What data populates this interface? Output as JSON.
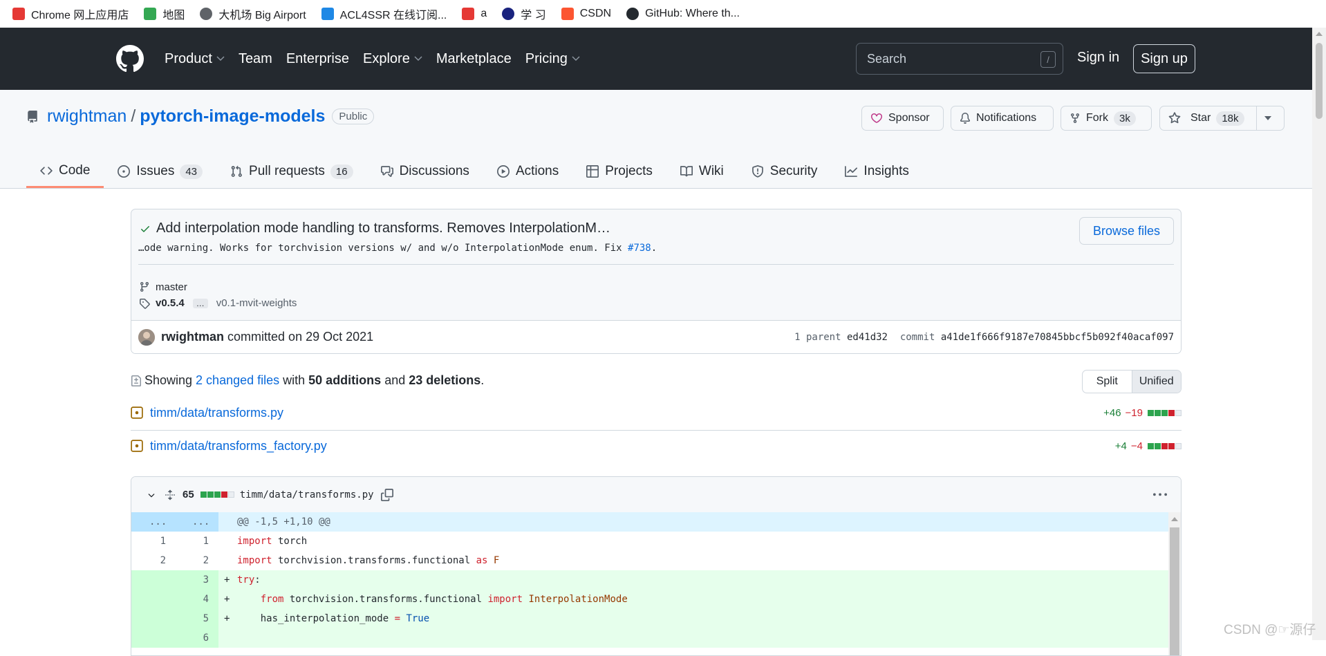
{
  "bookmarks": [
    {
      "label": "Chrome 网上应用店",
      "icon": "chrome-store-icon",
      "color": "#e53935"
    },
    {
      "label": "地图",
      "icon": "maps-icon",
      "color": "#34a853"
    },
    {
      "label": "大机场 Big Airport",
      "icon": "globe-icon",
      "color": "#5f6368"
    },
    {
      "label": "ACL4SSR 在线订阅...",
      "icon": "acl-icon",
      "color": "#1e88e5"
    },
    {
      "label": "a",
      "icon": "chrome-icon",
      "color": "#e53935"
    },
    {
      "label": "学 习",
      "icon": "learn-icon",
      "color": "#1a237e"
    },
    {
      "label": "CSDN",
      "icon": "csdn-icon",
      "color": "#fc5531"
    },
    {
      "label": "GitHub: Where th...",
      "icon": "github-icon",
      "color": "#24292f"
    }
  ],
  "header": {
    "nav": [
      {
        "label": "Product",
        "dropdown": true
      },
      {
        "label": "Team",
        "dropdown": false
      },
      {
        "label": "Enterprise",
        "dropdown": false
      },
      {
        "label": "Explore",
        "dropdown": true
      },
      {
        "label": "Marketplace",
        "dropdown": false
      },
      {
        "label": "Pricing",
        "dropdown": true
      }
    ],
    "search_placeholder": "Search",
    "search_key": "/",
    "signin": "Sign in",
    "signup": "Sign up"
  },
  "repo": {
    "owner": "rwightman",
    "separator": "/",
    "name": "pytorch-image-models",
    "visibility": "Public",
    "sponsor": "Sponsor",
    "notifications": "Notifications",
    "fork": "Fork",
    "fork_count": "3k",
    "star": "Star",
    "star_count": "18k"
  },
  "tabs": [
    {
      "label": "Code",
      "icon": "code-icon",
      "count": null,
      "active": true
    },
    {
      "label": "Issues",
      "icon": "issue-icon",
      "count": "43"
    },
    {
      "label": "Pull requests",
      "icon": "pull-request-icon",
      "count": "16"
    },
    {
      "label": "Discussions",
      "icon": "discussions-icon",
      "count": null
    },
    {
      "label": "Actions",
      "icon": "play-icon",
      "count": null
    },
    {
      "label": "Projects",
      "icon": "table-icon",
      "count": null
    },
    {
      "label": "Wiki",
      "icon": "book-icon",
      "count": null
    },
    {
      "label": "Security",
      "icon": "shield-icon",
      "count": null
    },
    {
      "label": "Insights",
      "icon": "graph-icon",
      "count": null
    }
  ],
  "commit": {
    "title": "Add interpolation mode handling to transforms. Removes InterpolationM…",
    "desc_text": "…ode warning. Works for torchvision versions w/ and w/o InterpolationMode enum. Fix ",
    "desc_link": "#738",
    "desc_end": ".",
    "browse": "Browse files",
    "branch": "master",
    "tag_first": "v0.5.4",
    "tag_ellipsis": "…",
    "tag_last": "v0.1-mvit-weights",
    "author": "rwightman",
    "committed": "committed on 29 Oct 2021",
    "parent_label": "1 parent",
    "parent_sha": "ed41d32",
    "commit_label": "commit",
    "commit_sha": "a41de1f666f9187e70845bbcf5b092f40acaf097"
  },
  "summary": {
    "showing": "Showing",
    "changed": "2 changed files",
    "with": "with",
    "additions": "50 additions",
    "and": "and",
    "deletions": "23 deletions",
    "end": ".",
    "split": "Split",
    "unified": "Unified"
  },
  "files": [
    {
      "name": "timm/data/transforms.py",
      "add": "+46",
      "del": "−19",
      "blocks": [
        "g",
        "g",
        "g",
        "r",
        "n"
      ]
    },
    {
      "name": "timm/data/transforms_factory.py",
      "add": "+4",
      "del": "−4",
      "blocks": [
        "g",
        "g",
        "r",
        "r",
        "n"
      ]
    }
  ],
  "diff": {
    "count": "65",
    "blocks": [
      "g",
      "g",
      "g",
      "r",
      "n"
    ],
    "path": "timm/data/transforms.py",
    "hunk_dots": "...",
    "hunk": "@@ -1,5 +1,10 @@",
    "lines": [
      {
        "type": "ctx",
        "old": "1",
        "new": "1",
        "sign": "",
        "segs": [
          [
            "kw",
            "import"
          ],
          [
            "t",
            " torch"
          ]
        ]
      },
      {
        "type": "ctx",
        "old": "2",
        "new": "2",
        "sign": "",
        "segs": [
          [
            "kw",
            "import"
          ],
          [
            "t",
            " torchvision.transforms.functional "
          ],
          [
            "kw",
            "as"
          ],
          [
            "t",
            " "
          ],
          [
            "cl",
            "F"
          ]
        ]
      },
      {
        "type": "add",
        "old": "",
        "new": "3",
        "sign": "+",
        "segs": [
          [
            "kw",
            "try"
          ],
          [
            "t",
            ":"
          ]
        ]
      },
      {
        "type": "add",
        "old": "",
        "new": "4",
        "sign": "+",
        "segs": [
          [
            "t",
            "    "
          ],
          [
            "kw",
            "from"
          ],
          [
            "t",
            " torchvision.transforms.functional "
          ],
          [
            "kw",
            "import"
          ],
          [
            "t",
            " "
          ],
          [
            "cl",
            "InterpolationMode"
          ]
        ]
      },
      {
        "type": "add",
        "old": "",
        "new": "5",
        "sign": "+",
        "segs": [
          [
            "t",
            "    has_interpolation_mode "
          ],
          [
            "kw",
            "="
          ],
          [
            "t",
            " "
          ],
          [
            "con",
            "True"
          ]
        ]
      },
      {
        "type": "add",
        "old": "",
        "new": "6",
        "sign": "",
        "segs": []
      }
    ]
  },
  "watermark": "CSDN @☞源仔"
}
